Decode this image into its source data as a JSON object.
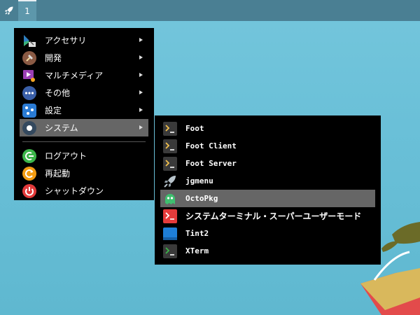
{
  "panel": {
    "workspace_label": "1"
  },
  "main_menu": {
    "items": [
      {
        "label": "アクセサリ",
        "icon": "accessories-icon",
        "has_submenu": true
      },
      {
        "label": "開発",
        "icon": "development-icon",
        "has_submenu": true
      },
      {
        "label": "マルチメディア",
        "icon": "multimedia-icon",
        "has_submenu": true
      },
      {
        "label": "その他",
        "icon": "other-icon",
        "has_submenu": true
      },
      {
        "label": "設定",
        "icon": "settings-icon",
        "has_submenu": true
      },
      {
        "label": "システム",
        "icon": "system-icon",
        "has_submenu": true,
        "active": true
      }
    ],
    "actions": [
      {
        "label": "ログアウト",
        "icon": "logout-icon"
      },
      {
        "label": "再起動",
        "icon": "reboot-icon"
      },
      {
        "label": "シャットダウン",
        "icon": "shutdown-icon"
      }
    ]
  },
  "system_submenu": {
    "items": [
      {
        "label": "Foot",
        "icon": "terminal-icon"
      },
      {
        "label": "Foot Client",
        "icon": "terminal-icon"
      },
      {
        "label": "Foot Server",
        "icon": "terminal-icon"
      },
      {
        "label": "jgmenu",
        "icon": "rocket-icon"
      },
      {
        "label": "OctoPkg",
        "icon": "octopkg-icon",
        "active": true
      },
      {
        "label": "システムターミナル・スーパーユーザーモード",
        "icon": "root-terminal-icon"
      },
      {
        "label": "Tint2",
        "icon": "panel-icon"
      },
      {
        "label": "XTerm",
        "icon": "xterm-icon"
      }
    ]
  },
  "colors": {
    "menu_bg": "#000000",
    "highlight": "#666666",
    "panel": "#4a7f93",
    "desktop": "#6ac0d8"
  }
}
